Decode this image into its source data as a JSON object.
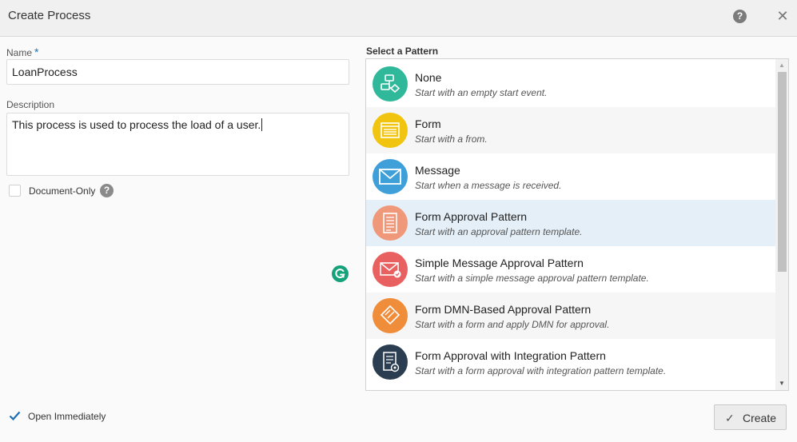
{
  "dialog": {
    "title": "Create Process",
    "help_icon": "?",
    "close_icon": "✕"
  },
  "form": {
    "name_label": "Name",
    "required_marker": "*",
    "name_value": "LoanProcess",
    "description_label": "Description",
    "description_value": "This process is used to process the load of a user.",
    "document_only_label": "Document-Only",
    "document_only_checked": false,
    "document_only_help": "?",
    "open_immediately_label": "Open Immediately",
    "open_immediately_checked": true
  },
  "patterns": {
    "heading": "Select a Pattern",
    "items": [
      {
        "title": "None",
        "description": "Start with an empty start event.",
        "icon": "flow-diagram-icon",
        "color": "#2fb89a"
      },
      {
        "title": "Form",
        "description": "Start with a from.",
        "icon": "form-icon",
        "color": "#f1c40f"
      },
      {
        "title": "Message",
        "description": "Start when a message is received.",
        "icon": "envelope-icon",
        "color": "#3f9fd9"
      },
      {
        "title": "Form Approval Pattern",
        "description": "Start with an approval pattern template.",
        "icon": "document-list-icon",
        "color": "#f0987a"
      },
      {
        "title": "Simple Message Approval Pattern",
        "description": "Start with a simple message approval pattern template.",
        "icon": "envelope-check-icon",
        "color": "#e8605f"
      },
      {
        "title": "Form DMN-Based Approval Pattern",
        "description": "Start with a form and apply DMN for approval.",
        "icon": "decision-diamond-icon",
        "color": "#f08d3a"
      },
      {
        "title": "Form Approval with Integration Pattern",
        "description": "Start with a form approval with integration pattern template.",
        "icon": "document-gear-icon",
        "color": "#2b3e51"
      }
    ],
    "selected_index": 3
  },
  "footer": {
    "create_label": "Create",
    "create_icon": "✓"
  }
}
